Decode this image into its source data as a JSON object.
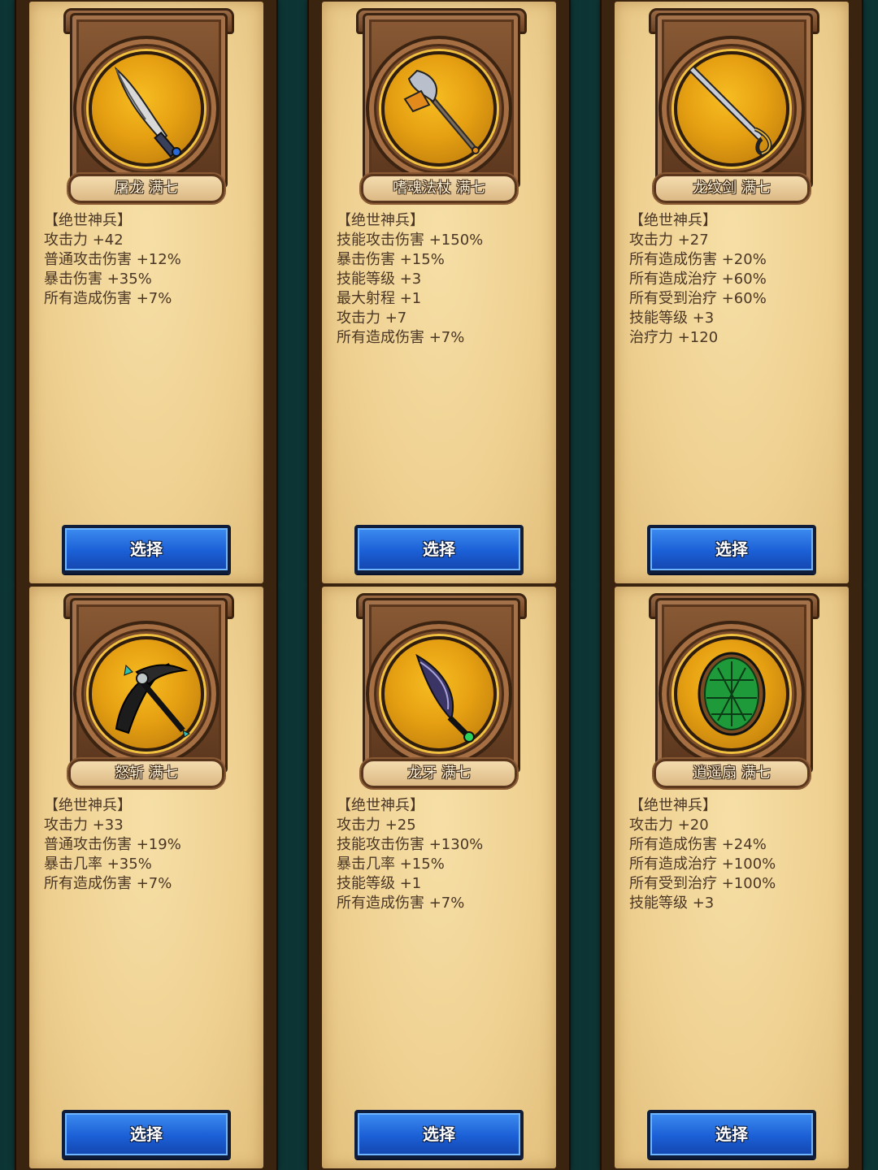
{
  "select_label": "选择",
  "grade_label": "【绝世神兵】",
  "cards": [
    {
      "name": "屠龙 满七",
      "icon": "dragon-slayer-blade-icon",
      "stats": [
        "攻击力 +42",
        "普通攻击伤害 +12%",
        "暴击伤害 +35%",
        "所有造成伤害 +7%"
      ]
    },
    {
      "name": "嗜魂法杖 满七",
      "icon": "soul-staff-icon",
      "stats": [
        "技能攻击伤害 +150%",
        "暴击伤害 +15%",
        "技能等级 +3",
        "最大射程 +1",
        "攻击力 +7",
        "所有造成伤害 +7%"
      ]
    },
    {
      "name": "龙纹剑 满七",
      "icon": "dragon-sword-icon",
      "stats": [
        "攻击力 +27",
        "所有造成伤害 +20%",
        "所有造成治疗 +60%",
        "所有受到治疗 +60%",
        "技能等级 +3",
        "治疗力 +120"
      ]
    },
    {
      "name": "怒斩 满七",
      "icon": "pickaxe-icon",
      "stats": [
        "攻击力 +33",
        "普通攻击伤害 +19%",
        "暴击几率 +35%",
        "所有造成伤害 +7%"
      ]
    },
    {
      "name": "龙牙 满七",
      "icon": "dragon-fang-dagger-icon",
      "stats": [
        "攻击力 +25",
        "技能攻击伤害 +130%",
        "暴击几率 +15%",
        "技能等级 +1",
        "所有造成伤害 +7%"
      ]
    },
    {
      "name": "逍遥扇 满七",
      "icon": "turtle-shell-icon",
      "stats": [
        "攻击力 +20",
        "所有造成伤害 +24%",
        "所有造成治疗 +100%",
        "所有受到治疗 +100%",
        "技能等级 +3"
      ]
    }
  ]
}
